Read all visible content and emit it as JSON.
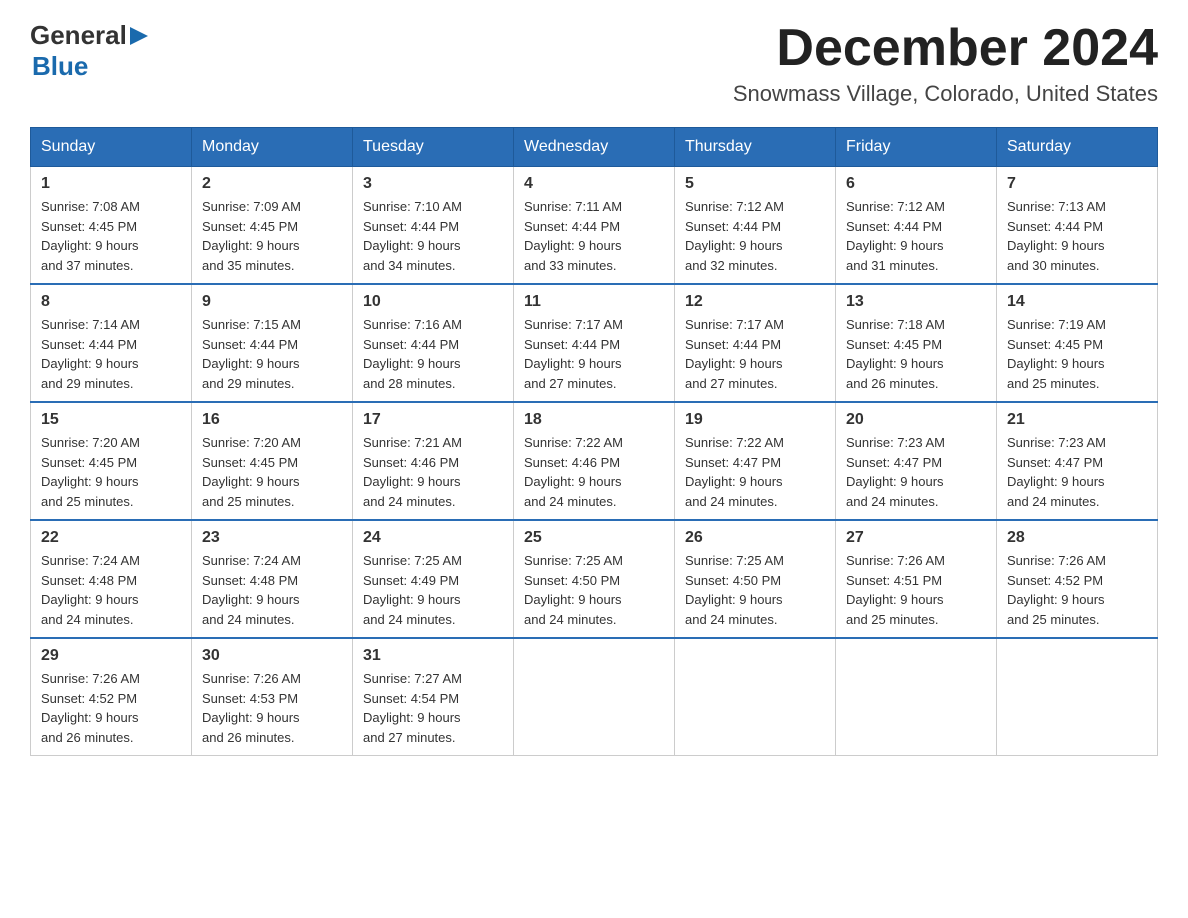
{
  "logo": {
    "general": "General",
    "blue": "Blue",
    "arrow": "▶"
  },
  "title": "December 2024",
  "subtitle": "Snowmass Village, Colorado, United States",
  "days_of_week": [
    "Sunday",
    "Monday",
    "Tuesday",
    "Wednesday",
    "Thursday",
    "Friday",
    "Saturday"
  ],
  "weeks": [
    [
      {
        "day": "1",
        "sunrise": "7:08 AM",
        "sunset": "4:45 PM",
        "daylight": "9 hours and 37 minutes."
      },
      {
        "day": "2",
        "sunrise": "7:09 AM",
        "sunset": "4:45 PM",
        "daylight": "9 hours and 35 minutes."
      },
      {
        "day": "3",
        "sunrise": "7:10 AM",
        "sunset": "4:44 PM",
        "daylight": "9 hours and 34 minutes."
      },
      {
        "day": "4",
        "sunrise": "7:11 AM",
        "sunset": "4:44 PM",
        "daylight": "9 hours and 33 minutes."
      },
      {
        "day": "5",
        "sunrise": "7:12 AM",
        "sunset": "4:44 PM",
        "daylight": "9 hours and 32 minutes."
      },
      {
        "day": "6",
        "sunrise": "7:12 AM",
        "sunset": "4:44 PM",
        "daylight": "9 hours and 31 minutes."
      },
      {
        "day": "7",
        "sunrise": "7:13 AM",
        "sunset": "4:44 PM",
        "daylight": "9 hours and 30 minutes."
      }
    ],
    [
      {
        "day": "8",
        "sunrise": "7:14 AM",
        "sunset": "4:44 PM",
        "daylight": "9 hours and 29 minutes."
      },
      {
        "day": "9",
        "sunrise": "7:15 AM",
        "sunset": "4:44 PM",
        "daylight": "9 hours and 29 minutes."
      },
      {
        "day": "10",
        "sunrise": "7:16 AM",
        "sunset": "4:44 PM",
        "daylight": "9 hours and 28 minutes."
      },
      {
        "day": "11",
        "sunrise": "7:17 AM",
        "sunset": "4:44 PM",
        "daylight": "9 hours and 27 minutes."
      },
      {
        "day": "12",
        "sunrise": "7:17 AM",
        "sunset": "4:44 PM",
        "daylight": "9 hours and 27 minutes."
      },
      {
        "day": "13",
        "sunrise": "7:18 AM",
        "sunset": "4:45 PM",
        "daylight": "9 hours and 26 minutes."
      },
      {
        "day": "14",
        "sunrise": "7:19 AM",
        "sunset": "4:45 PM",
        "daylight": "9 hours and 25 minutes."
      }
    ],
    [
      {
        "day": "15",
        "sunrise": "7:20 AM",
        "sunset": "4:45 PM",
        "daylight": "9 hours and 25 minutes."
      },
      {
        "day": "16",
        "sunrise": "7:20 AM",
        "sunset": "4:45 PM",
        "daylight": "9 hours and 25 minutes."
      },
      {
        "day": "17",
        "sunrise": "7:21 AM",
        "sunset": "4:46 PM",
        "daylight": "9 hours and 24 minutes."
      },
      {
        "day": "18",
        "sunrise": "7:22 AM",
        "sunset": "4:46 PM",
        "daylight": "9 hours and 24 minutes."
      },
      {
        "day": "19",
        "sunrise": "7:22 AM",
        "sunset": "4:47 PM",
        "daylight": "9 hours and 24 minutes."
      },
      {
        "day": "20",
        "sunrise": "7:23 AM",
        "sunset": "4:47 PM",
        "daylight": "9 hours and 24 minutes."
      },
      {
        "day": "21",
        "sunrise": "7:23 AM",
        "sunset": "4:47 PM",
        "daylight": "9 hours and 24 minutes."
      }
    ],
    [
      {
        "day": "22",
        "sunrise": "7:24 AM",
        "sunset": "4:48 PM",
        "daylight": "9 hours and 24 minutes."
      },
      {
        "day": "23",
        "sunrise": "7:24 AM",
        "sunset": "4:48 PM",
        "daylight": "9 hours and 24 minutes."
      },
      {
        "day": "24",
        "sunrise": "7:25 AM",
        "sunset": "4:49 PM",
        "daylight": "9 hours and 24 minutes."
      },
      {
        "day": "25",
        "sunrise": "7:25 AM",
        "sunset": "4:50 PM",
        "daylight": "9 hours and 24 minutes."
      },
      {
        "day": "26",
        "sunrise": "7:25 AM",
        "sunset": "4:50 PM",
        "daylight": "9 hours and 24 minutes."
      },
      {
        "day": "27",
        "sunrise": "7:26 AM",
        "sunset": "4:51 PM",
        "daylight": "9 hours and 25 minutes."
      },
      {
        "day": "28",
        "sunrise": "7:26 AM",
        "sunset": "4:52 PM",
        "daylight": "9 hours and 25 minutes."
      }
    ],
    [
      {
        "day": "29",
        "sunrise": "7:26 AM",
        "sunset": "4:52 PM",
        "daylight": "9 hours and 26 minutes."
      },
      {
        "day": "30",
        "sunrise": "7:26 AM",
        "sunset": "4:53 PM",
        "daylight": "9 hours and 26 minutes."
      },
      {
        "day": "31",
        "sunrise": "7:27 AM",
        "sunset": "4:54 PM",
        "daylight": "9 hours and 27 minutes."
      },
      null,
      null,
      null,
      null
    ]
  ]
}
